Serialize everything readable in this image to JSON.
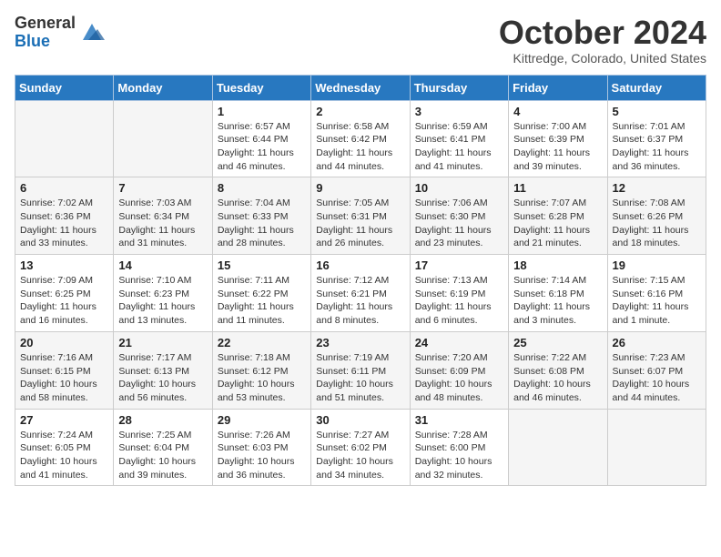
{
  "header": {
    "logo": {
      "general": "General",
      "blue": "Blue"
    },
    "title": "October 2024",
    "location": "Kittredge, Colorado, United States"
  },
  "calendar": {
    "days_of_week": [
      "Sunday",
      "Monday",
      "Tuesday",
      "Wednesday",
      "Thursday",
      "Friday",
      "Saturday"
    ],
    "weeks": [
      [
        {
          "day": "",
          "info": ""
        },
        {
          "day": "",
          "info": ""
        },
        {
          "day": "1",
          "info": "Sunrise: 6:57 AM\nSunset: 6:44 PM\nDaylight: 11 hours and 46 minutes."
        },
        {
          "day": "2",
          "info": "Sunrise: 6:58 AM\nSunset: 6:42 PM\nDaylight: 11 hours and 44 minutes."
        },
        {
          "day": "3",
          "info": "Sunrise: 6:59 AM\nSunset: 6:41 PM\nDaylight: 11 hours and 41 minutes."
        },
        {
          "day": "4",
          "info": "Sunrise: 7:00 AM\nSunset: 6:39 PM\nDaylight: 11 hours and 39 minutes."
        },
        {
          "day": "5",
          "info": "Sunrise: 7:01 AM\nSunset: 6:37 PM\nDaylight: 11 hours and 36 minutes."
        }
      ],
      [
        {
          "day": "6",
          "info": "Sunrise: 7:02 AM\nSunset: 6:36 PM\nDaylight: 11 hours and 33 minutes."
        },
        {
          "day": "7",
          "info": "Sunrise: 7:03 AM\nSunset: 6:34 PM\nDaylight: 11 hours and 31 minutes."
        },
        {
          "day": "8",
          "info": "Sunrise: 7:04 AM\nSunset: 6:33 PM\nDaylight: 11 hours and 28 minutes."
        },
        {
          "day": "9",
          "info": "Sunrise: 7:05 AM\nSunset: 6:31 PM\nDaylight: 11 hours and 26 minutes."
        },
        {
          "day": "10",
          "info": "Sunrise: 7:06 AM\nSunset: 6:30 PM\nDaylight: 11 hours and 23 minutes."
        },
        {
          "day": "11",
          "info": "Sunrise: 7:07 AM\nSunset: 6:28 PM\nDaylight: 11 hours and 21 minutes."
        },
        {
          "day": "12",
          "info": "Sunrise: 7:08 AM\nSunset: 6:26 PM\nDaylight: 11 hours and 18 minutes."
        }
      ],
      [
        {
          "day": "13",
          "info": "Sunrise: 7:09 AM\nSunset: 6:25 PM\nDaylight: 11 hours and 16 minutes."
        },
        {
          "day": "14",
          "info": "Sunrise: 7:10 AM\nSunset: 6:23 PM\nDaylight: 11 hours and 13 minutes."
        },
        {
          "day": "15",
          "info": "Sunrise: 7:11 AM\nSunset: 6:22 PM\nDaylight: 11 hours and 11 minutes."
        },
        {
          "day": "16",
          "info": "Sunrise: 7:12 AM\nSunset: 6:21 PM\nDaylight: 11 hours and 8 minutes."
        },
        {
          "day": "17",
          "info": "Sunrise: 7:13 AM\nSunset: 6:19 PM\nDaylight: 11 hours and 6 minutes."
        },
        {
          "day": "18",
          "info": "Sunrise: 7:14 AM\nSunset: 6:18 PM\nDaylight: 11 hours and 3 minutes."
        },
        {
          "day": "19",
          "info": "Sunrise: 7:15 AM\nSunset: 6:16 PM\nDaylight: 11 hours and 1 minute."
        }
      ],
      [
        {
          "day": "20",
          "info": "Sunrise: 7:16 AM\nSunset: 6:15 PM\nDaylight: 10 hours and 58 minutes."
        },
        {
          "day": "21",
          "info": "Sunrise: 7:17 AM\nSunset: 6:13 PM\nDaylight: 10 hours and 56 minutes."
        },
        {
          "day": "22",
          "info": "Sunrise: 7:18 AM\nSunset: 6:12 PM\nDaylight: 10 hours and 53 minutes."
        },
        {
          "day": "23",
          "info": "Sunrise: 7:19 AM\nSunset: 6:11 PM\nDaylight: 10 hours and 51 minutes."
        },
        {
          "day": "24",
          "info": "Sunrise: 7:20 AM\nSunset: 6:09 PM\nDaylight: 10 hours and 48 minutes."
        },
        {
          "day": "25",
          "info": "Sunrise: 7:22 AM\nSunset: 6:08 PM\nDaylight: 10 hours and 46 minutes."
        },
        {
          "day": "26",
          "info": "Sunrise: 7:23 AM\nSunset: 6:07 PM\nDaylight: 10 hours and 44 minutes."
        }
      ],
      [
        {
          "day": "27",
          "info": "Sunrise: 7:24 AM\nSunset: 6:05 PM\nDaylight: 10 hours and 41 minutes."
        },
        {
          "day": "28",
          "info": "Sunrise: 7:25 AM\nSunset: 6:04 PM\nDaylight: 10 hours and 39 minutes."
        },
        {
          "day": "29",
          "info": "Sunrise: 7:26 AM\nSunset: 6:03 PM\nDaylight: 10 hours and 36 minutes."
        },
        {
          "day": "30",
          "info": "Sunrise: 7:27 AM\nSunset: 6:02 PM\nDaylight: 10 hours and 34 minutes."
        },
        {
          "day": "31",
          "info": "Sunrise: 7:28 AM\nSunset: 6:00 PM\nDaylight: 10 hours and 32 minutes."
        },
        {
          "day": "",
          "info": ""
        },
        {
          "day": "",
          "info": ""
        }
      ]
    ]
  }
}
